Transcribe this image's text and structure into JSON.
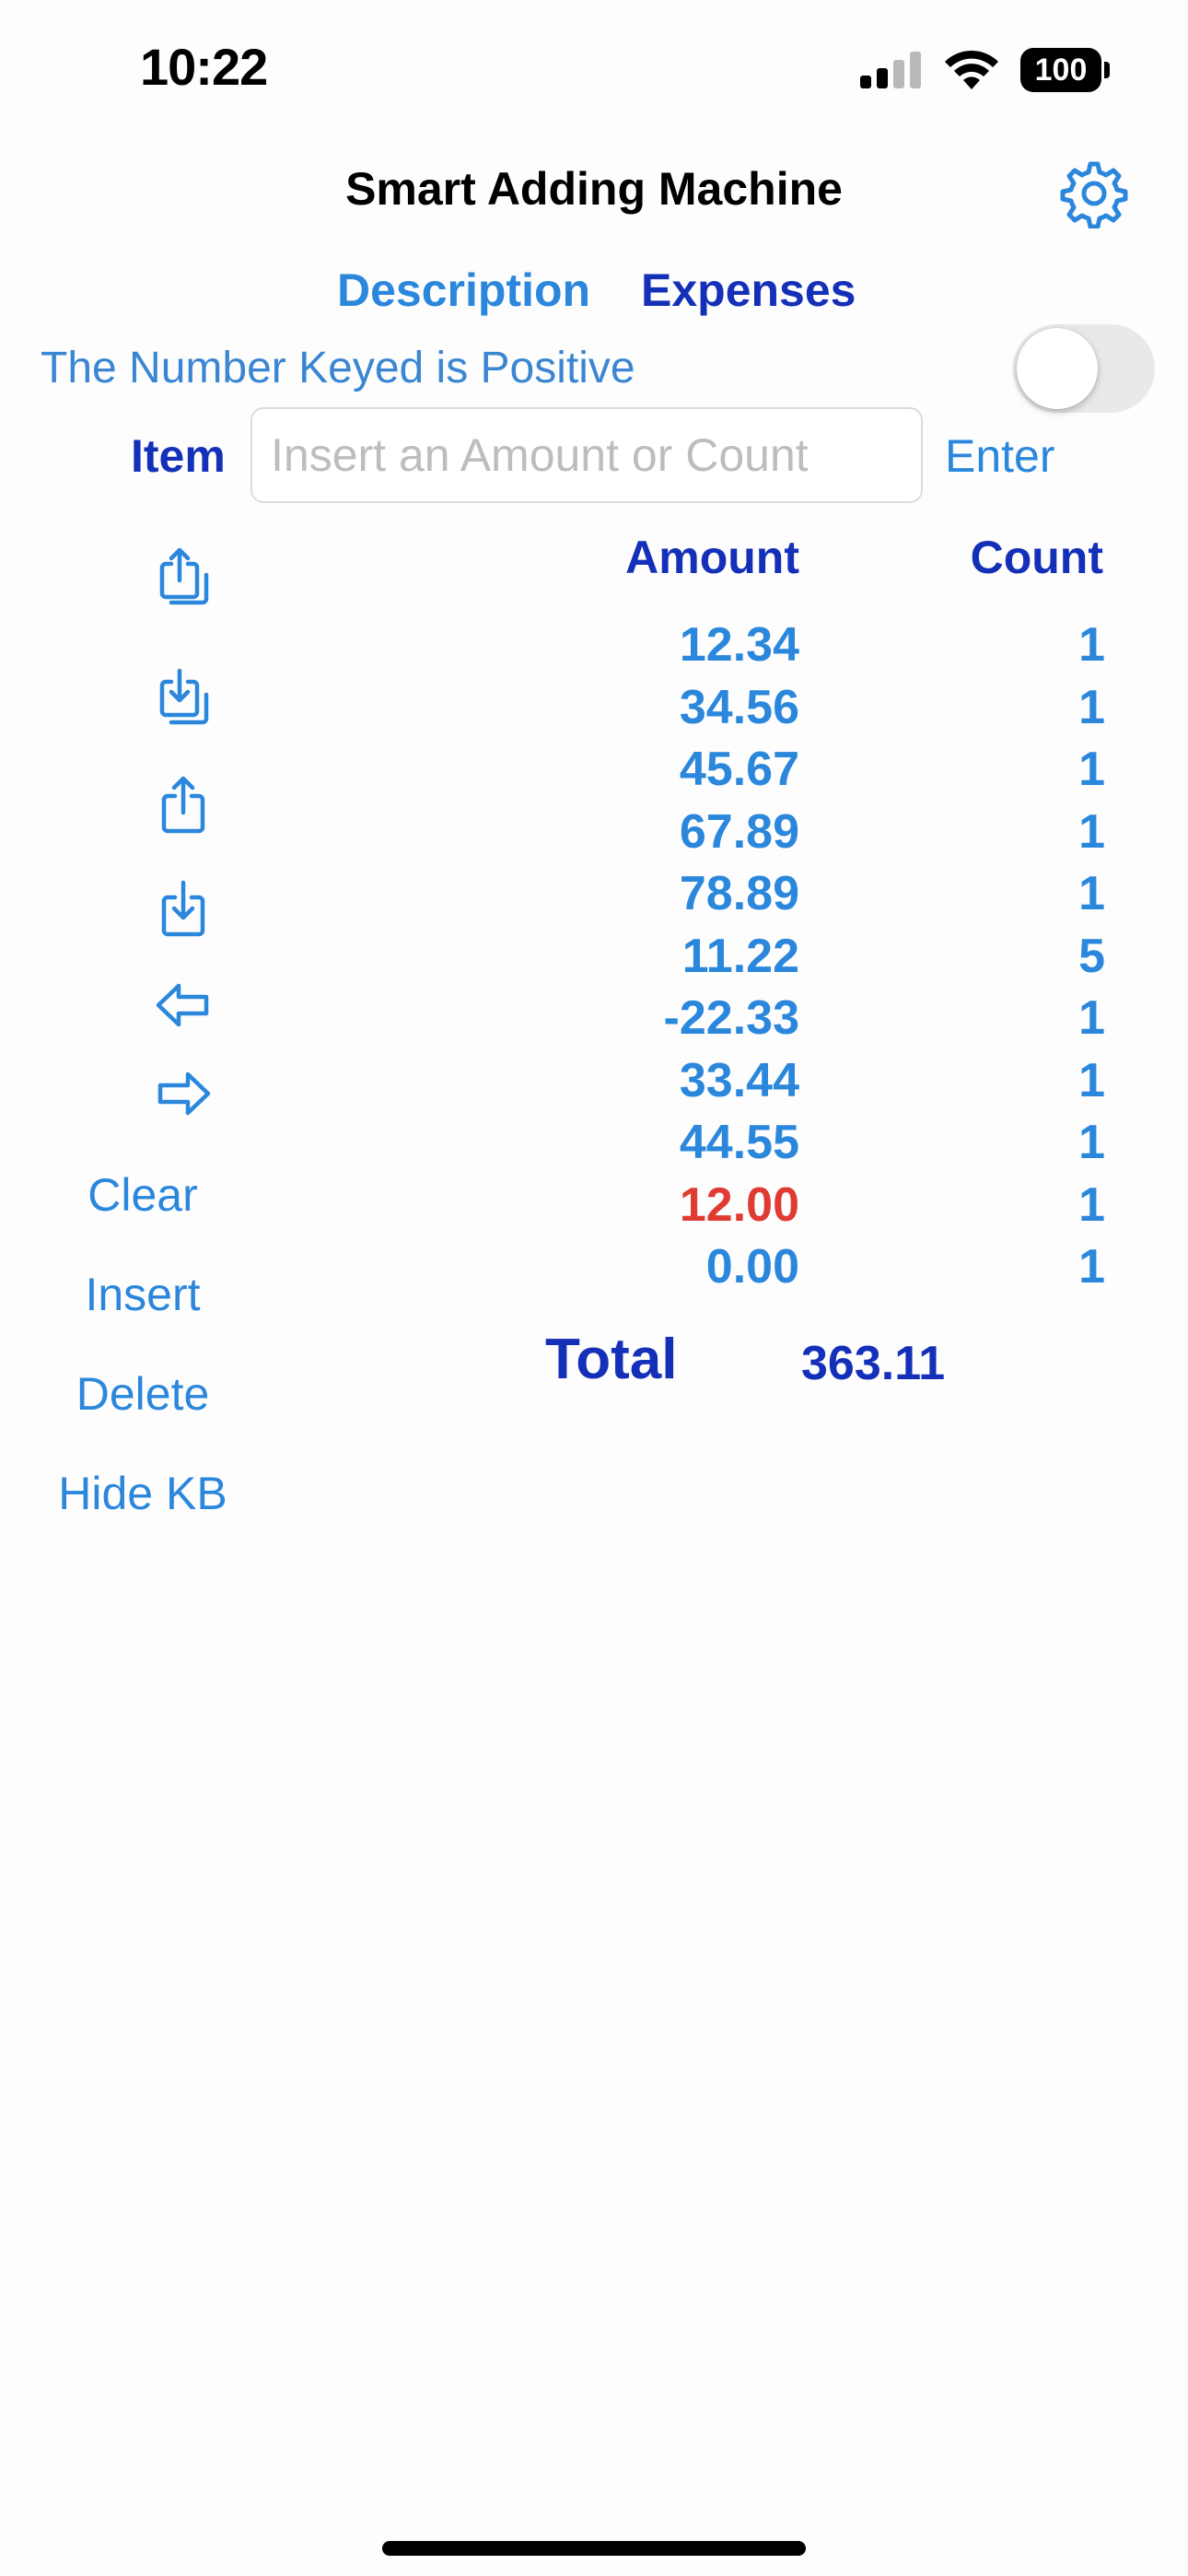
{
  "status_bar": {
    "time": "10:22",
    "battery": "100"
  },
  "header": {
    "title": "Smart Adding Machine",
    "settings_icon": "gear-icon"
  },
  "tabs": [
    {
      "label": "Description"
    },
    {
      "label": "Expenses"
    }
  ],
  "sign_toggle": {
    "label": "The Number Keyed is Positive",
    "on": false
  },
  "entry": {
    "label": "Item",
    "placeholder": "Insert an Amount or Count",
    "value": "",
    "enter_label": "Enter"
  },
  "tools": {
    "icons": [
      "export-stack-icon",
      "import-stack-icon",
      "share-icon",
      "download-icon",
      "arrow-left-icon",
      "arrow-right-icon"
    ],
    "buttons": [
      "Clear",
      "Insert",
      "Delete",
      "Hide KB"
    ]
  },
  "table": {
    "headers": {
      "amount": "Amount",
      "count": "Count"
    },
    "rows": [
      {
        "amount": "12.34",
        "count": "1"
      },
      {
        "amount": "34.56",
        "count": "1"
      },
      {
        "amount": "45.67",
        "count": "1"
      },
      {
        "amount": "67.89",
        "count": "1"
      },
      {
        "amount": "78.89",
        "count": "1"
      },
      {
        "amount": "11.22",
        "count": "5"
      },
      {
        "amount": "-22.33",
        "count": "1"
      },
      {
        "amount": "33.44",
        "count": "1"
      },
      {
        "amount": "44.55",
        "count": "1"
      },
      {
        "amount": "12.00",
        "count": "1",
        "highlight": "#e03b33"
      },
      {
        "amount": "0.00",
        "count": "1"
      }
    ]
  },
  "total": {
    "label": "Total",
    "value": "363.11"
  },
  "colors": {
    "accent": "#2b87dc",
    "dark_accent": "#1530b8",
    "highlight": "#e03b33"
  }
}
